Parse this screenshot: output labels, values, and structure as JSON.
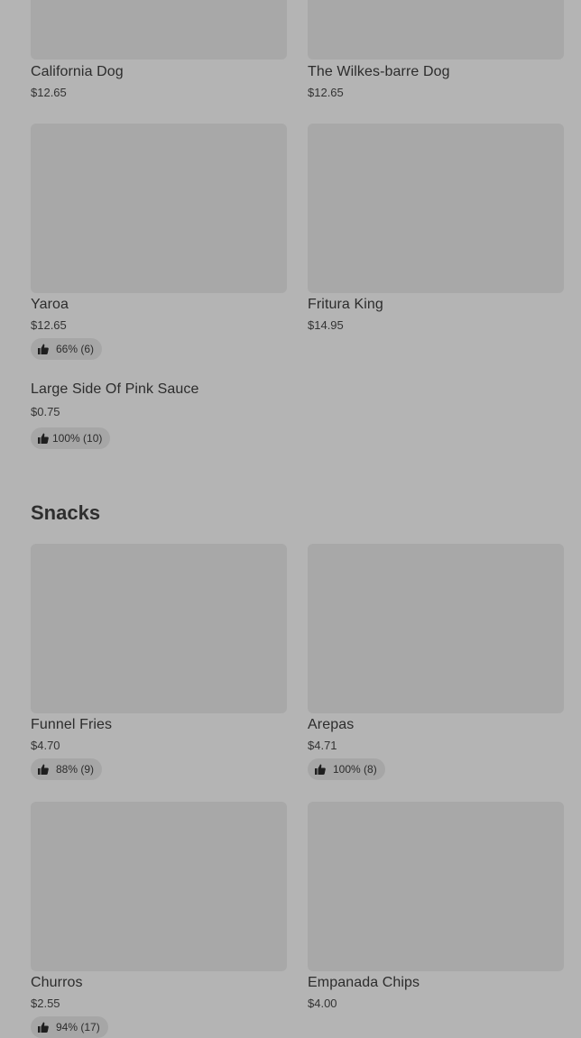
{
  "top_items": [
    {
      "name": "California Dog",
      "price": "$12.65"
    },
    {
      "name": "The Wilkes-barre Dog",
      "price": "$12.65"
    }
  ],
  "items_row2": [
    {
      "name": "Yaroa",
      "price": "$12.65",
      "rating": "66% (6)"
    },
    {
      "name": "Fritura King",
      "price": "$14.95"
    }
  ],
  "text_item": {
    "name": "Large Side Of Pink Sauce",
    "price": "$0.75",
    "rating": "100% (10)"
  },
  "snacks": {
    "title": "Snacks",
    "items": [
      {
        "name": "Funnel Fries",
        "price": "$4.70",
        "rating": "88% (9)"
      },
      {
        "name": "Arepas",
        "price": "$4.71",
        "rating": "100% (8)"
      },
      {
        "name": "Churros",
        "price": "$2.55",
        "rating": "94% (17)"
      },
      {
        "name": "Empanada Chips",
        "price": "$4.00"
      }
    ]
  },
  "icons": {
    "rating": "thumbs-up-icon"
  },
  "colors": {
    "background": "#b4b4b4",
    "image_placeholder": "#a8a8a8",
    "badge": "#a6a6a6"
  }
}
